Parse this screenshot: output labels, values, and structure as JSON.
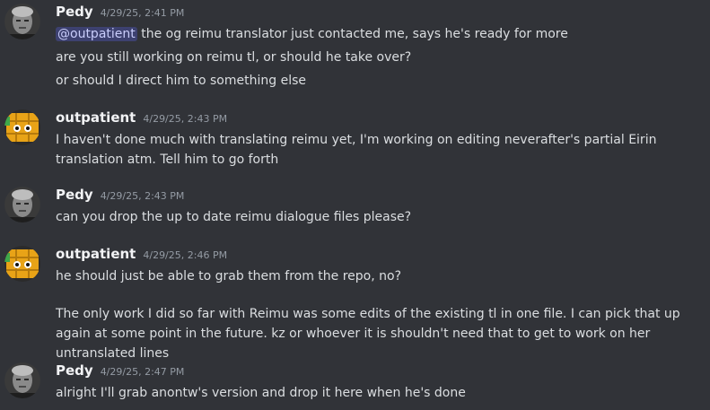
{
  "messages": [
    {
      "author": "Pedy",
      "timestamp": "4/29/25, 2:41 PM",
      "lines": [
        {
          "mention": "@outpatient",
          "text": " the og reimu translator just contacted me, says he's ready for more"
        },
        {
          "text": "are you still working on reimu tl, or should he take over?"
        },
        {
          "text": "or should I direct him to something else"
        }
      ]
    },
    {
      "author": "outpatient",
      "timestamp": "4/29/25, 2:43 PM",
      "lines": [
        {
          "text": "I haven't done much with translating reimu yet, I'm working on editing neverafter's partial Eirin translation atm. Tell him to go forth"
        }
      ]
    },
    {
      "author": "Pedy",
      "timestamp": "4/29/25, 2:43 PM",
      "lines": [
        {
          "text": "can you drop the up to date reimu dialogue files please?"
        }
      ]
    },
    {
      "author": "outpatient",
      "timestamp": "4/29/25, 2:46 PM",
      "lines": [
        {
          "text": "he should just be able to grab them from the repo, no?"
        },
        {
          "text": "The only work I did so far with Reimu was some edits of the existing tl in one file. I can pick that up again at some point in the future. kz or whoever it is shouldn't need that to get to work on her untranslated lines"
        }
      ]
    },
    {
      "author": "Pedy",
      "timestamp": "4/29/25, 2:47 PM",
      "lines": [
        {
          "text": "alright I'll grab anontw's version and drop it here when he's done"
        }
      ]
    }
  ]
}
